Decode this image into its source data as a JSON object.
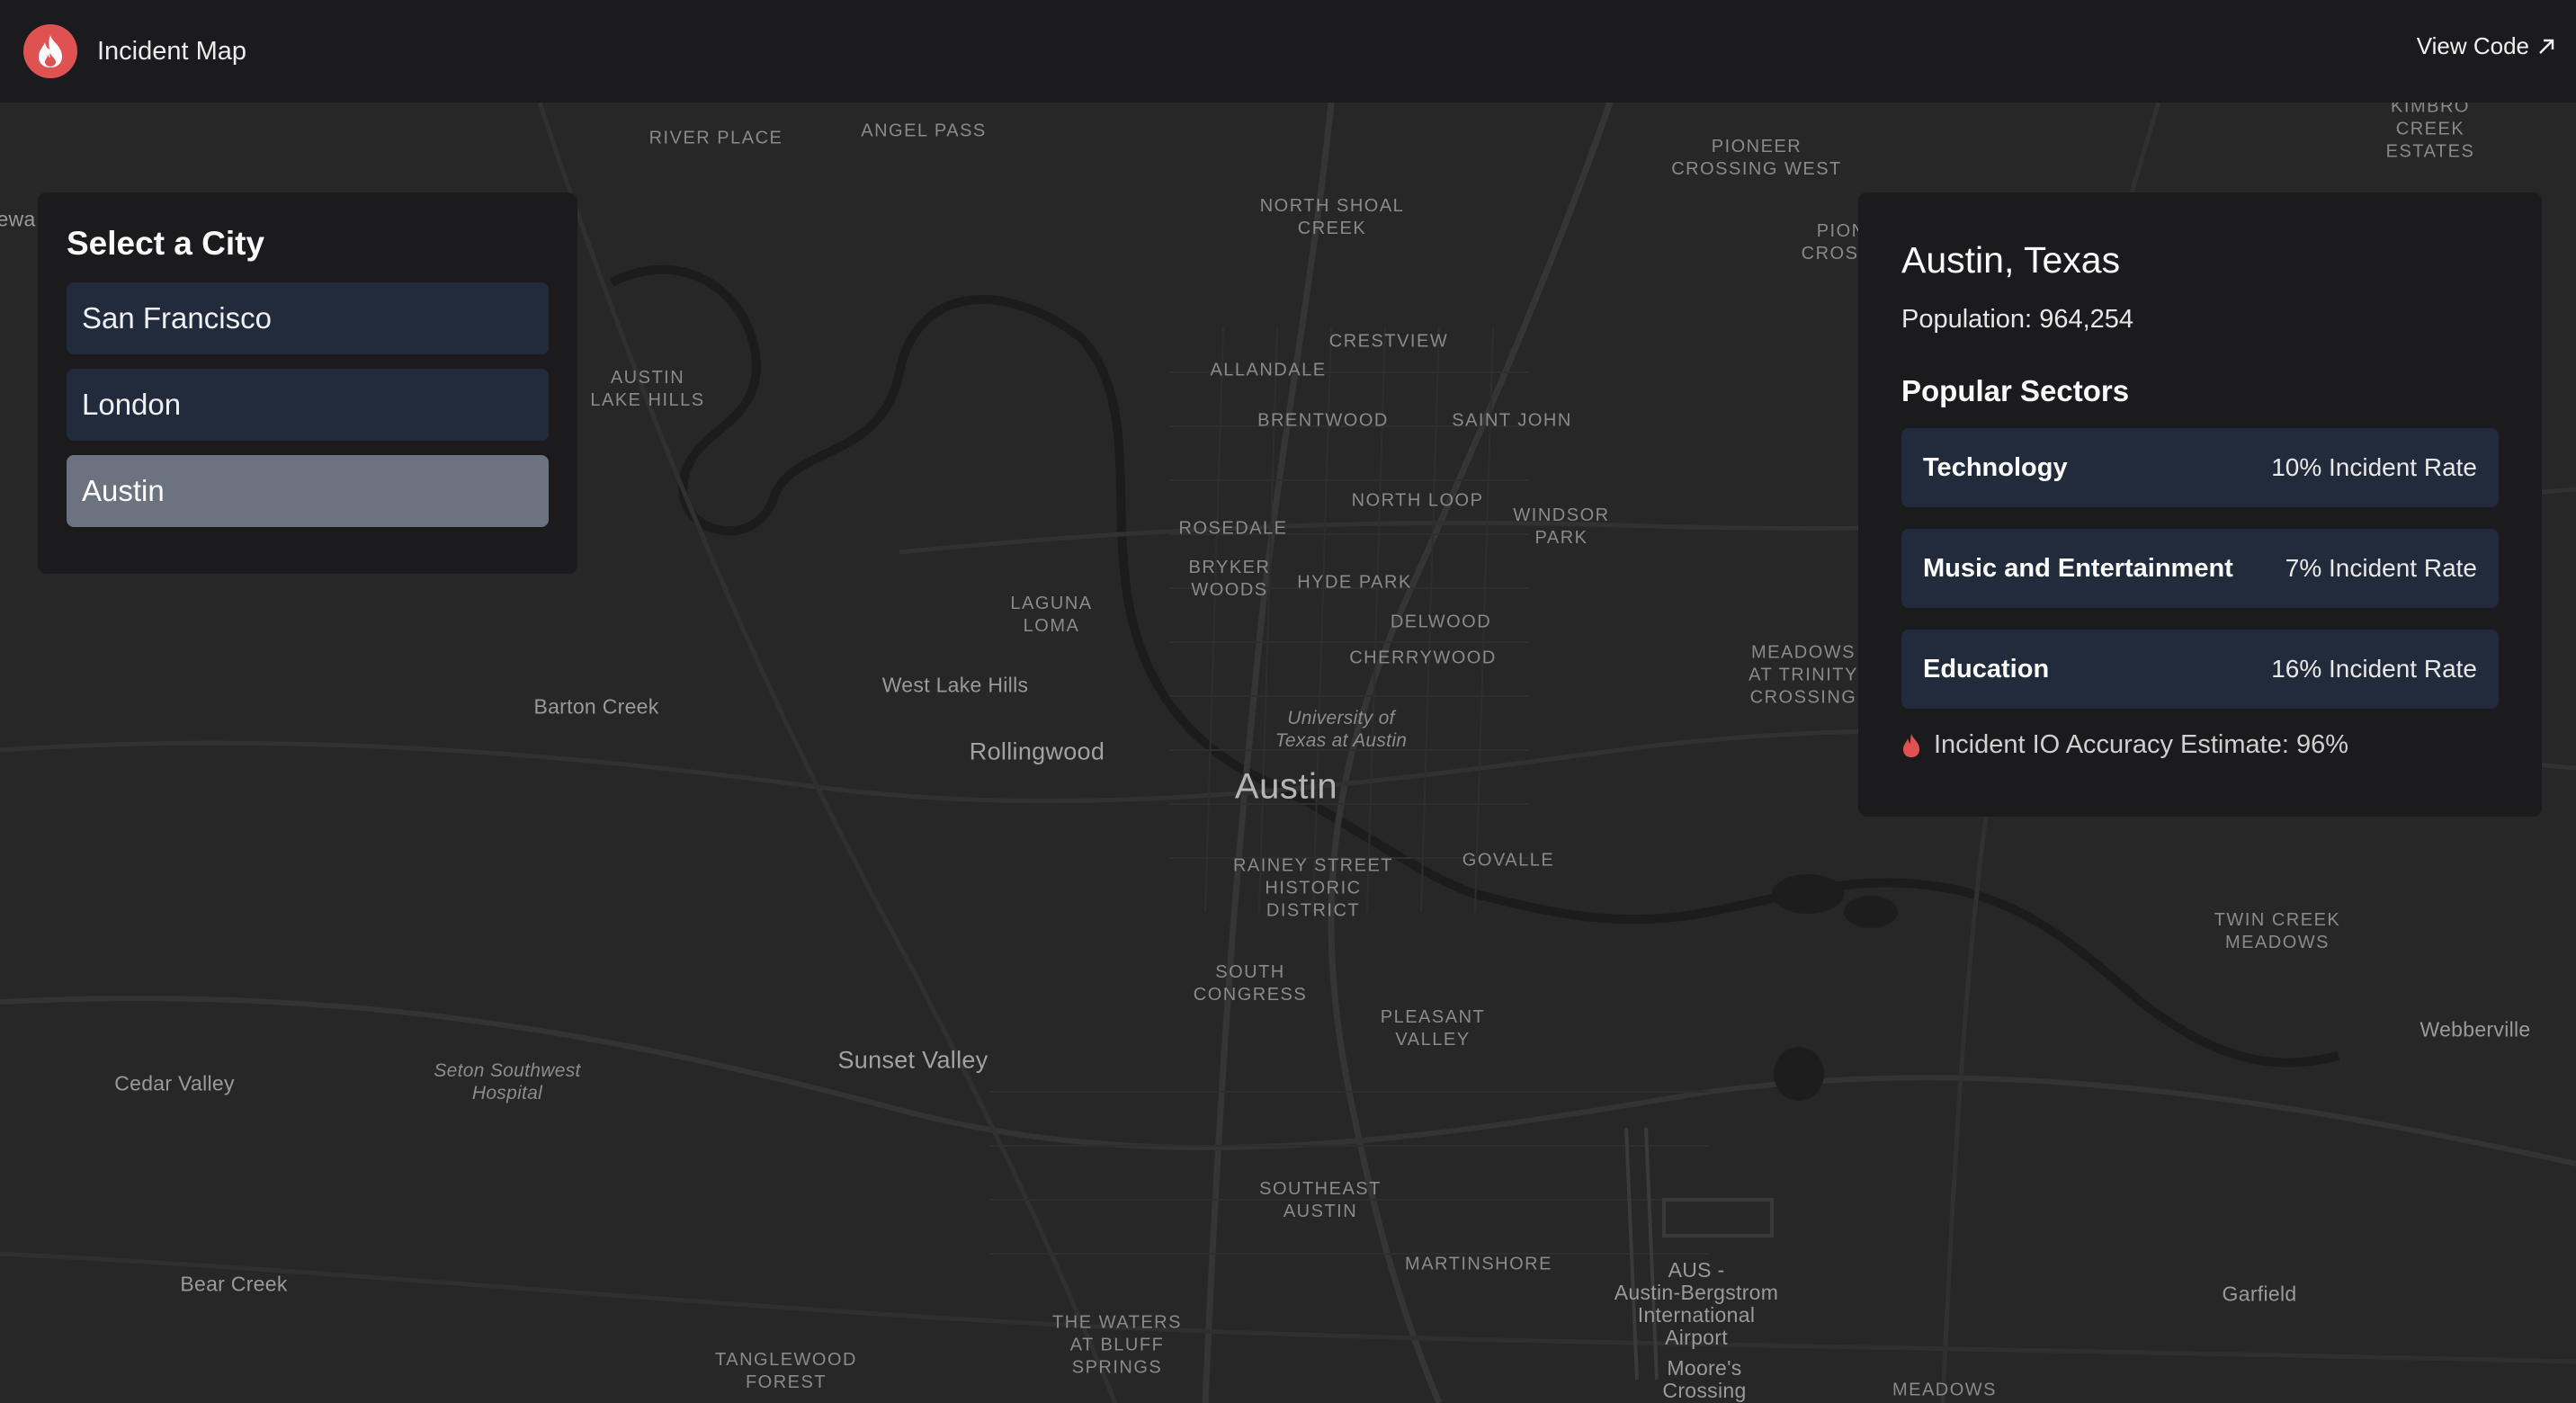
{
  "header": {
    "app_title": "Incident Map",
    "view_code_label": "View Code",
    "logo_icon": "flame-icon",
    "accent_color": "#e05252"
  },
  "city_selector": {
    "title": "Select a City",
    "cities": [
      {
        "label": "San Francisco",
        "selected": false
      },
      {
        "label": "London",
        "selected": false
      },
      {
        "label": "Austin",
        "selected": true
      }
    ]
  },
  "details": {
    "city_name": "Austin, Texas",
    "population_label": "Population:",
    "population_value": "964,254",
    "sectors_title": "Popular Sectors",
    "sectors": [
      {
        "name": "Technology",
        "rate": "10% Incident Rate"
      },
      {
        "name": "Music and Entertainment",
        "rate": "7% Incident Rate"
      },
      {
        "name": "Education",
        "rate": "16% Incident Rate"
      }
    ],
    "accuracy_text": "Incident IO Accuracy Estimate: 96%"
  },
  "map_labels": [
    {
      "text": "RIVER PLACE",
      "style": "upper"
    },
    {
      "text": "ANGEL PASS",
      "style": "upper"
    },
    {
      "text": "NORTH SHOAL\nCREEK",
      "style": "upper"
    },
    {
      "text": "PIONEER\nCROSSING WEST",
      "style": "upper"
    },
    {
      "text": "KIMBRO CREEK\nESTATES",
      "style": "upper"
    },
    {
      "text": "PIONEE\nCROSSING",
      "style": "upper"
    },
    {
      "text": "CRESTVIEW",
      "style": "upper"
    },
    {
      "text": "ALLANDALE",
      "style": "upper"
    },
    {
      "text": "AUSTIN\nLAKE HILLS",
      "style": "upper"
    },
    {
      "text": "BRENTWOOD",
      "style": "upper"
    },
    {
      "text": "SAINT JOHN",
      "style": "upper"
    },
    {
      "text": "NORTH LOOP",
      "style": "upper"
    },
    {
      "text": "ROSEDALE",
      "style": "upper"
    },
    {
      "text": "WINDSOR\nPARK",
      "style": "upper"
    },
    {
      "text": "BRYKER\nWOODS",
      "style": "upper"
    },
    {
      "text": "HYDE PARK",
      "style": "upper"
    },
    {
      "text": "LAGUNA\nLOMA",
      "style": "upper"
    },
    {
      "text": "DELWOOD",
      "style": "upper"
    },
    {
      "text": "CHERRYWOOD",
      "style": "upper"
    },
    {
      "text": "MEADOWS\nAT TRINITY\nCROSSING",
      "style": "upper"
    },
    {
      "text": "West Lake Hills",
      "style": "place"
    },
    {
      "text": "Barton Creek",
      "style": "place"
    },
    {
      "text": "University of\nTexas at Austin",
      "style": "italic"
    },
    {
      "text": "Rollingwood",
      "style": "mid"
    },
    {
      "text": "Austin",
      "style": "big"
    },
    {
      "text": "RAINEY STREET\nHISTORIC\nDISTRICT",
      "style": "upper"
    },
    {
      "text": "GOVALLE",
      "style": "upper"
    },
    {
      "text": "TWIN CREEK\nMEADOWS",
      "style": "upper"
    },
    {
      "text": "SOUTH\nCONGRESS",
      "style": "upper"
    },
    {
      "text": "PLEASANT\nVALLEY",
      "style": "upper"
    },
    {
      "text": "Webberville",
      "style": "place"
    },
    {
      "text": "Sunset Valley",
      "style": "mid"
    },
    {
      "text": "Seton Southwest\nHospital",
      "style": "italic"
    },
    {
      "text": "Cedar Valley",
      "style": "place"
    },
    {
      "text": "SOUTHEAST\nAUSTIN",
      "style": "upper"
    },
    {
      "text": "MARTINSHORE",
      "style": "upper"
    },
    {
      "text": "AUS -\nAustin-Bergstrom\nInternational\nAirport",
      "style": "place"
    },
    {
      "text": "Bear Creek",
      "style": "place"
    },
    {
      "text": "Garfield",
      "style": "place"
    },
    {
      "text": "THE WATERS\nAT BLUFF\nSPRINGS",
      "style": "upper"
    },
    {
      "text": "TANGLEWOOD\nFOREST",
      "style": "upper"
    },
    {
      "text": "Moore's\nCrossing",
      "style": "place"
    },
    {
      "text": "MEADOWS",
      "style": "upper"
    },
    {
      "text": "ewa",
      "style": "place"
    }
  ]
}
